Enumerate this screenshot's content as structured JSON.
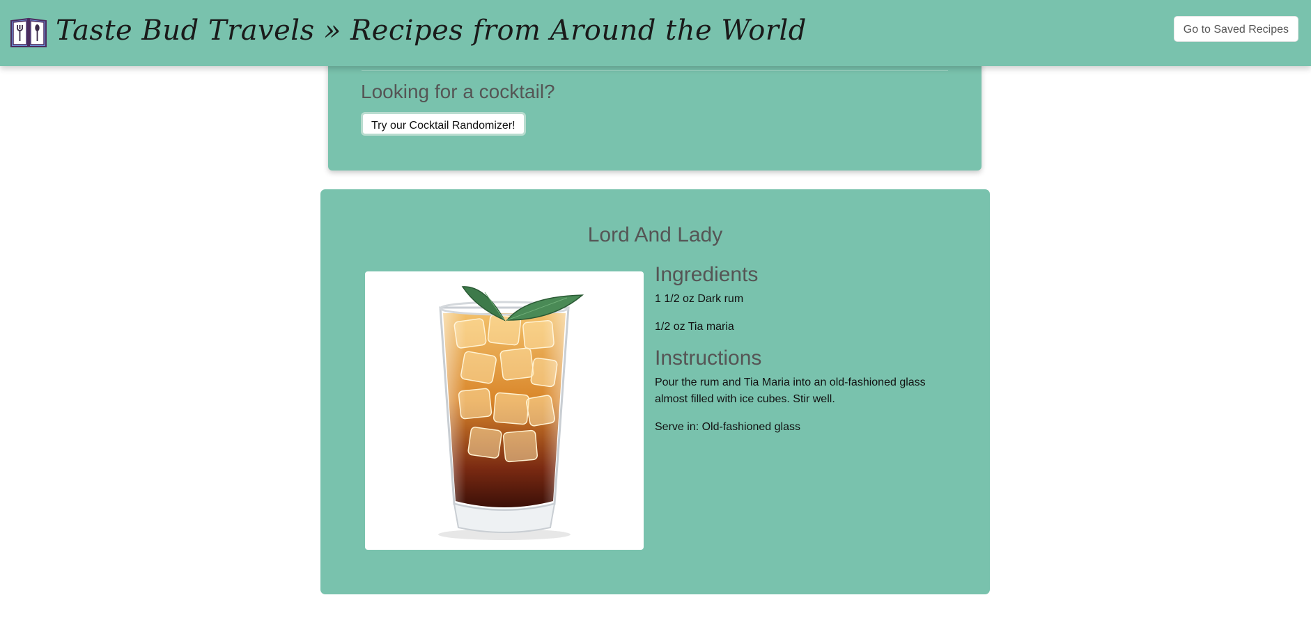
{
  "header": {
    "title": "Taste Bud Travels » Recipes from Around the World",
    "saved_button": "Go to Saved Recipes",
    "logo_icon": "recipe-book-icon",
    "color": "#79c2ad"
  },
  "cocktail_prompt": {
    "heading": "Looking for a cocktail?",
    "button": "Try our Cocktail Randomizer!"
  },
  "recipe": {
    "name": "Lord And Lady",
    "image_icon": "cocktail-glass-image",
    "ingredients_heading": "Ingredients",
    "ingredients": [
      "1 1/2 oz Dark rum",
      "1/2 oz Tia maria"
    ],
    "instructions_heading": "Instructions",
    "instructions": "Pour the rum and Tia Maria into an old-fashioned glass almost filled with ice cubes. Stir well.",
    "serve_in": "Serve in: Old-fashioned glass"
  }
}
